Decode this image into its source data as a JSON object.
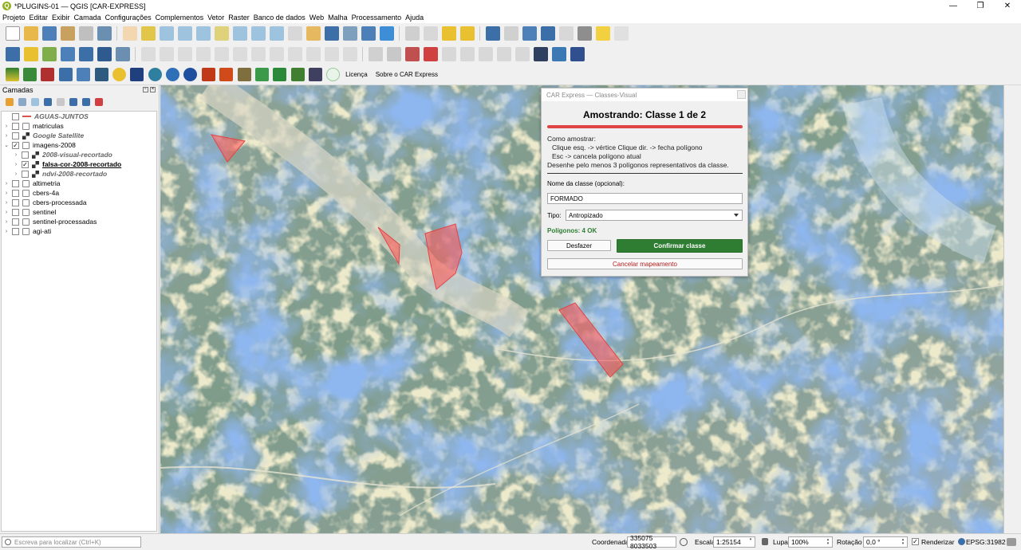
{
  "window": {
    "title": "*PLUGINS-01 — QGIS [CAR-EXPRESS]",
    "logo_letter": "Q",
    "controls": [
      "—",
      "❐",
      "✕"
    ]
  },
  "menu": [
    "Projeto",
    "Editar",
    "Exibir",
    "Camada",
    "Configurações",
    "Complementos",
    "Vetor",
    "Raster",
    "Banco de dados",
    "Web",
    "Malha",
    "Processamento",
    "Ajuda"
  ],
  "toolbar3_links": {
    "license": "Licença",
    "about": "Sobre o CAR Express"
  },
  "panel": {
    "title": "Camadas",
    "layers": [
      {
        "name": "AGUAS-JUNTOS",
        "indent": 0,
        "arrow": "",
        "checked": false,
        "type": "line",
        "style": "italic"
      },
      {
        "name": "matriculas",
        "indent": 0,
        "arrow": "›",
        "checked": false,
        "type": "group",
        "style": ""
      },
      {
        "name": "Google Satellite",
        "indent": 0,
        "arrow": "›",
        "checked": false,
        "type": "raster",
        "style": "italic"
      },
      {
        "name": "imagens-2008",
        "indent": 0,
        "arrow": "⌄",
        "checked": true,
        "type": "group",
        "style": ""
      },
      {
        "name": "2008-visual-recortado",
        "indent": 1,
        "arrow": "›",
        "checked": false,
        "type": "raster",
        "style": "italic"
      },
      {
        "name": "falsa-cor-2008-recortado",
        "indent": 1,
        "arrow": "›",
        "checked": true,
        "type": "raster",
        "style": "active"
      },
      {
        "name": "ndvi-2008-recortado",
        "indent": 1,
        "arrow": "›",
        "checked": false,
        "type": "raster",
        "style": "italic"
      },
      {
        "name": "altimetria",
        "indent": 0,
        "arrow": "›",
        "checked": false,
        "type": "group",
        "style": ""
      },
      {
        "name": "cbers-4a",
        "indent": 0,
        "arrow": "›",
        "checked": false,
        "type": "group",
        "style": ""
      },
      {
        "name": "cbers-processada",
        "indent": 0,
        "arrow": "›",
        "checked": false,
        "type": "group",
        "style": ""
      },
      {
        "name": "sentinel",
        "indent": 0,
        "arrow": "›",
        "checked": false,
        "type": "group",
        "style": ""
      },
      {
        "name": "sentinel-processadas",
        "indent": 0,
        "arrow": "›",
        "checked": false,
        "type": "group",
        "style": ""
      },
      {
        "name": "agi-ati",
        "indent": 0,
        "arrow": "›",
        "checked": false,
        "type": "group",
        "style": ""
      }
    ]
  },
  "dialog": {
    "window_title": "CAR Express — Classes-Visual",
    "heading": "Amostrando: Classe 1 de 2",
    "instructions_title": "Como amostrar:",
    "instruction_line1": "Clique esq. -> vértice     Clique dir. -> fecha polígono",
    "instruction_line2": "Esc -> cancela polígono atual",
    "instruction_line3": "Desenhe pelo menos 3 polígonos representativos da classe.",
    "class_name_label": "Nome da classe (opcional):",
    "class_name_value": "FORMADO",
    "type_label": "Tipo:",
    "type_value": "Antropizado",
    "polygons_status": "Polígonos: 4 OK",
    "undo_label": "Desfazer",
    "confirm_label": "Confirmar classe",
    "cancel_label": "Cancelar mapeamento"
  },
  "statusbar": {
    "locator_placeholder": "Escreva para localizar (Ctrl+K)",
    "coord_label": "Coordenada",
    "coord_value": "335075  8033503",
    "scale_label": "Escala",
    "scale_value": "1:25154",
    "magnifier_label": "Lupa",
    "magnifier_value": "100%",
    "rotation_label": "Rotação",
    "rotation_value": "0,0 °",
    "render_label": "Renderizar",
    "crs": "EPSG:31982"
  },
  "colors": {
    "accent_green": "#2e7d32",
    "progress_red": "#e04545",
    "polygon_fill": "#ff5a5a",
    "cancel_red": "#b71c1c"
  }
}
